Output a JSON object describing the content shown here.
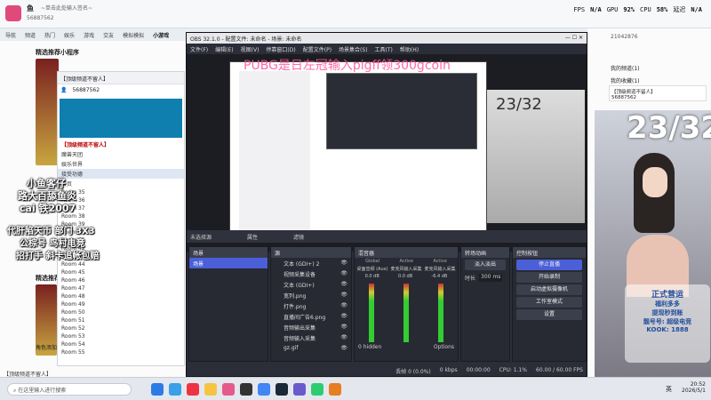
{
  "topbar": {
    "app_name": "鱼",
    "subtitle": "~单击此处输入签名~",
    "counts": "56887562",
    "hud": {
      "fps_label": "FPS",
      "fps": "N/A",
      "gpu_label": "GPU",
      "gpu": "92%",
      "cpu_label": "CPU",
      "cpu": "58%",
      "net_label": "延迟",
      "net": "N/A"
    }
  },
  "navtabs": [
    "导航",
    "频道",
    "热门",
    "娱乐",
    "游戏",
    "交友",
    "模拟模拟",
    "小游戏"
  ],
  "left": {
    "section1": "精选推荐小程序",
    "section2": "精选推荐",
    "banner_top": "【顶级频道不留人】",
    "user_count": "56887562",
    "tree_header": "【顶级频道不留人】",
    "tree": [
      "魔兽天团",
      "娱乐世界",
      "接受功德",
      "首页",
      "Room 35",
      "Room 36",
      "Room 37",
      "Room 38",
      "Room 39",
      "Room 40",
      "Room 41",
      "Room 42",
      "Room 43",
      "Room 44",
      "Room 45",
      "Room 46",
      "Room 47",
      "Room 48",
      "Room 49",
      "Room 50",
      "Room 51",
      "Room 52",
      "Room 53",
      "Room 54",
      "Room 55"
    ],
    "overlay_lines": [
      "小鱼客仔",
      "路大百舔鱼炎",
      "cai 铁2007",
      "代肝陷天币 部门 3X3",
      "公棕号 鸟村电竞",
      "招打手 斜卡追帐包赔"
    ],
    "corner_text": "角色添加至"
  },
  "obs": {
    "title": "OBS 32.1.0 - 配置文件: 未命名 - 场景: 未命名",
    "menu": [
      "文件(F)",
      "编辑(E)",
      "视图(V)",
      "停靠窗口(D)",
      "配置文件(P)",
      "场景集合(S)",
      "工具(T)",
      "帮助(H)"
    ],
    "watermark": "PUBG是日左冠输入pigff领300gcoin",
    "nested_counter": "23/32",
    "status_left": "未选择源",
    "props_label": "属性",
    "filter_label": "滤镜",
    "docks": {
      "scenes": "场景",
      "sources": "源",
      "mixer": "混音器",
      "transitions": "转场动画",
      "controls": "控制按钮"
    },
    "scene_list": [
      "场景"
    ],
    "sources_list": [
      "文本 (GDI+) 2",
      "视频采集设备",
      "文本 (GDI+)",
      "宽列.png",
      "打件.png",
      "直播间广告6.png",
      "音频输出采集",
      "音频输入采集",
      "gz.gif"
    ],
    "mixer": {
      "channels": [
        {
          "label": "Global",
          "name": "桌面音频 (Aux)",
          "level": "0.0 dB"
        },
        {
          "label": "Active",
          "name": "麦克风输入采集",
          "level": "0.0 dB"
        },
        {
          "label": "Active",
          "name": "麦克风输入采集",
          "level": "-6.4 dB"
        }
      ],
      "hidden_label": "0 hidden",
      "options_label": "Options"
    },
    "transitions": {
      "type": "淡入淡出",
      "duration_label": "时长",
      "duration": "300 ms"
    },
    "controls": [
      "停止直播",
      "开始录制",
      "启动虚拟摄像机",
      "工作室模式",
      "设置"
    ],
    "statusbar": {
      "frames": "丢帧 0 (0.0%)",
      "kbps": "0 kbps",
      "cpu": "CPU: 1.1%",
      "fps": "60.00 / 60.00 FPS",
      "time": "00:00:00"
    }
  },
  "right": {
    "user_id": "21042876",
    "my_channel": "我的频道",
    "my_channel_count": "(1)",
    "fav_channel": "我的收藏",
    "fav_channel_count": "(1)",
    "channel_name": "【顶级频道不留人】",
    "channel_id": "56887562",
    "counter": "23/32",
    "logo_text": "正式营运",
    "logo_lines": [
      "福利多多",
      "提现秒到账",
      "靓号号: 超级电竞",
      "KOOK: 1888"
    ]
  },
  "taskbar": {
    "search_placeholder": "在这里输入进行搜索",
    "time": "20:52",
    "date": "2026/5/1",
    "lang": "英"
  },
  "footer_banner": "【顶级频道不留人】"
}
